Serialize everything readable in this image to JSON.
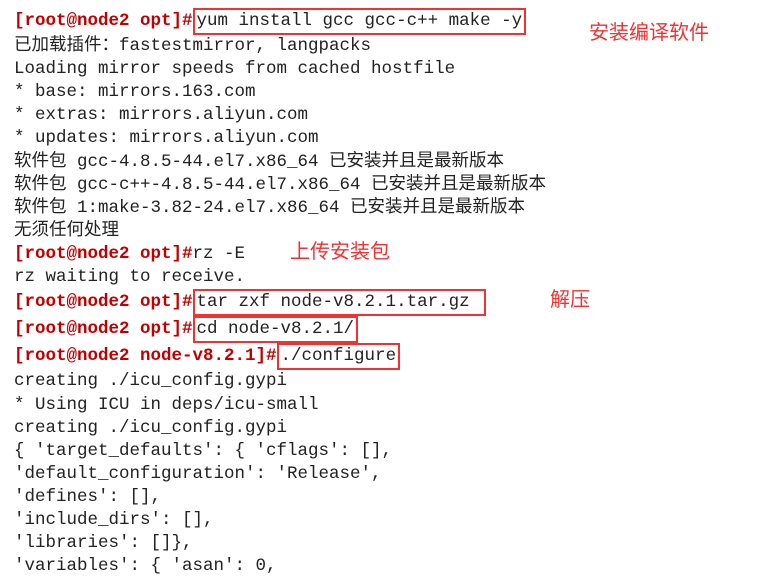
{
  "prompts": {
    "p_opt": "[root@node2 opt]#",
    "p_node": "[root@node2 node-v8.2.1]#"
  },
  "cmds": {
    "yum": "yum install gcc gcc-c++ make -y",
    "rz": "rz -E",
    "tar": "tar zxf node-v8.2.1.tar.gz",
    "cd": "cd node-v8.2.1/",
    "conf": "./configure"
  },
  "out": {
    "o1": "已加载插件：fastestmirror, langpacks",
    "o2": "Loading mirror speeds from cached hostfile",
    "o3": " * base: mirrors.163.com",
    "o4": " * extras: mirrors.aliyun.com",
    "o5": " * updates: mirrors.aliyun.com",
    "o6": "软件包 gcc-4.8.5-44.el7.x86_64 已安装并且是最新版本",
    "o7": "软件包 gcc-c++-4.8.5-44.el7.x86_64 已安装并且是最新版本",
    "o8": "软件包 1:make-3.82-24.el7.x86_64 已安装并且是最新版本",
    "o9": "无须任何处理",
    "o10": "rz waiting to receive.",
    "o11": "creating ./icu_config.gypi",
    "o12": "* Using ICU in deps/icu-small",
    "o13": "creating ./icu_config.gypi",
    "o14": "{ 'target_defaults': { 'cflags': [],",
    "o15": "                       'default_configuration': 'Release',",
    "o16": "                       'defines': [],",
    "o17": "                       'include_dirs': [],",
    "o18": "                       'libraries': []},",
    "o19": "  'variables': { 'asan': 0,"
  },
  "annots": {
    "a1": "安装编译软件",
    "a2": "上传安装包",
    "a3": "解压"
  }
}
